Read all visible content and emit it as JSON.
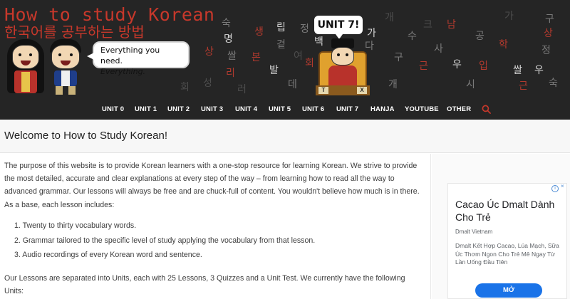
{
  "header": {
    "title": "How to study Korean",
    "subtitle": "한국어를 공부하는 방법",
    "speech_line1": "Everything you need.",
    "speech_line2": "Everything.",
    "unit_badge": "UNIT 7!",
    "king_sign_left": "T",
    "king_sign_right": "X",
    "bg_chars": [
      "숙",
      "명",
      "쌀",
      "리",
      "상",
      "성",
      "생",
      "본",
      "발",
      "겉",
      "러",
      "데",
      "립",
      "정",
      "여",
      "회",
      "가",
      "다",
      "백",
      "개",
      "수",
      "크",
      "구",
      "근",
      "사",
      "남",
      "공",
      "학",
      "우",
      "입",
      "시"
    ]
  },
  "nav": {
    "items": [
      "UNIT 0",
      "UNIT 1",
      "UNIT 2",
      "UNIT 3",
      "UNIT 4",
      "UNIT 5",
      "UNIT 6",
      "UNIT 7",
      "HANJA",
      "YOUTUBE",
      "OTHER"
    ],
    "search_icon": "search-icon"
  },
  "welcome": {
    "title": "Welcome to How to Study Korean!"
  },
  "main": {
    "intro": "The purpose of this website is to provide Korean learners with a one-stop resource for learning Korean. We strive to provide the most detailed, accurate and clear explanations at every step of the way – from learning how to read all the way to advanced grammar. Our lessons will always be free and are chuck-full of content. You wouldn't believe how much is in there. As a base, each lesson includes:",
    "list": [
      "1. Twenty to thirty vocabulary words.",
      "2. Grammar tailored to the specific level of study applying the vocabulary from that lesson.",
      "3. Audio recordings of every Korean word and sentence."
    ],
    "outro": "Our Lessons are separated into Units, each with 25 Lessons, 3 Quizzes and a Unit Test. We currently have the following Units:"
  },
  "ad": {
    "title": "Cacao Úc Dmalt Dành Cho Trẻ",
    "brand": "Dmalt Vietnam",
    "description": "Dmalt Kết Hợp Cacao, Lúa Mạch, Sữa Úc Thơm Ngon Cho Trẻ Mê Ngay Từ Lần Uống Đầu Tiên",
    "button": "MỞ",
    "choices_icon": "i",
    "close_icon": "×"
  },
  "colors": {
    "banner_bg": "#252525",
    "title_red": "#c7382b",
    "ad_button": "#1a73e8",
    "search_icon": "#c7382b"
  }
}
